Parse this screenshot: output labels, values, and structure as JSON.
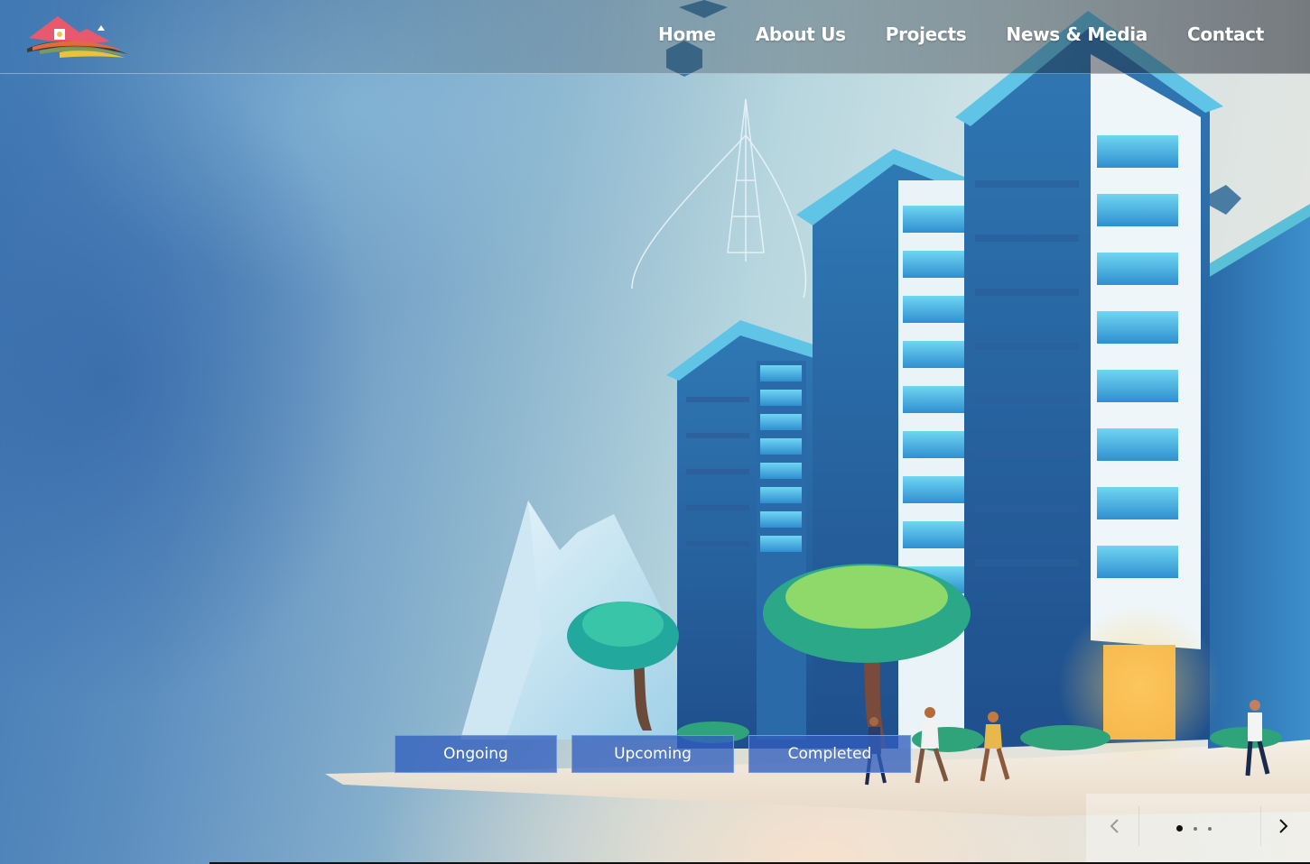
{
  "header": {
    "logo_name": "house-logo",
    "nav": [
      {
        "label": "Home"
      },
      {
        "label": "About Us"
      },
      {
        "label": "Projects"
      },
      {
        "label": "News & Media"
      },
      {
        "label": "Contact"
      }
    ]
  },
  "hero": {
    "filters": [
      {
        "label": "Ongoing"
      },
      {
        "label": "Upcoming"
      },
      {
        "label": "Completed"
      }
    ]
  },
  "carousel": {
    "prev_icon": "chevron-left-icon",
    "next_icon": "chevron-right-icon",
    "slides": 3,
    "active_slide": 1
  },
  "colors": {
    "button_bg": "#325fbe",
    "nav_text": "#ffffff",
    "building_blue": "#2f6fb0",
    "building_cyan": "#5fc4e6"
  }
}
